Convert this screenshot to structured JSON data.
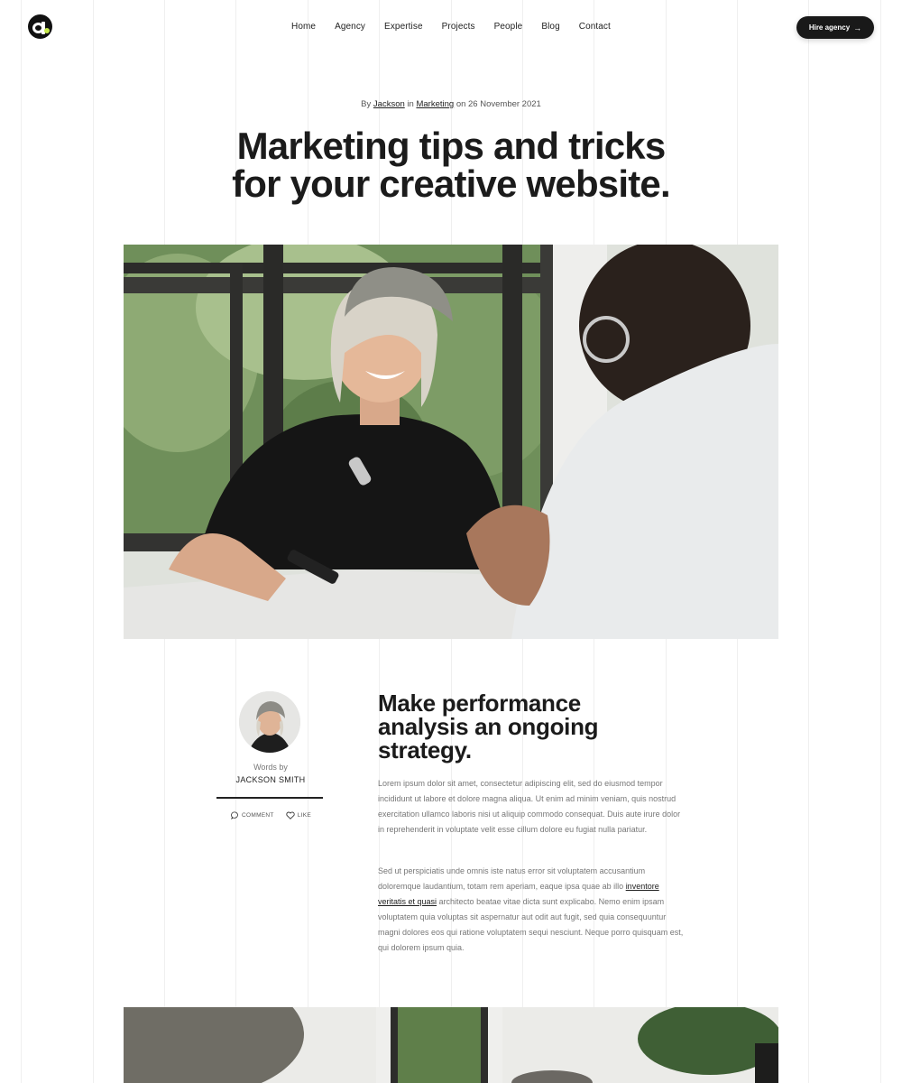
{
  "nav": {
    "items": [
      {
        "label": "Home"
      },
      {
        "label": "Agency"
      },
      {
        "label": "Expertise"
      },
      {
        "label": "Projects"
      },
      {
        "label": "People"
      },
      {
        "label": "Blog"
      },
      {
        "label": "Contact"
      }
    ],
    "cta_label": "Hire agency"
  },
  "post": {
    "meta": {
      "by": "By",
      "author": "Jackson",
      "in": "in",
      "category": "Marketing",
      "on": "on 26 November 2021"
    },
    "title_line1": "Marketing tips and tricks",
    "title_line2": "for your creative website."
  },
  "author": {
    "words_by": "Words by",
    "name": "JACKSON SMITH",
    "comment_label": "COMMENT",
    "like_label": "LIKE"
  },
  "article": {
    "heading": "Make performance analysis an ongoing strategy.",
    "paragraph1": "Lorem ipsum dolor sit amet, consectetur adipiscing elit, sed do eiusmod tempor incididunt ut labore et dolore magna aliqua. Ut enim ad minim veniam, quis nostrud exercitation ullamco laboris nisi ut aliquip commodo consequat. Duis aute irure dolor in reprehenderit in voluptate velit esse cillum dolore eu fugiat nulla pariatur.",
    "paragraph2_before": "Sed ut perspiciatis unde omnis iste natus error sit voluptatem accusantium doloremque laudantium, totam rem aperiam, eaque ipsa quae ab illo",
    "paragraph2_link": "inventore veritatis et quasi",
    "paragraph2_after": "architecto beatae vitae dicta sunt explicabo. Nemo enim ipsam voluptatem quia voluptas sit aspernatur aut odit aut fugit, sed quia consequuntur magni dolores eos qui ratione voluptatem sequi nesciunt. Neque porro quisquam est, qui dolorem ipsum quia."
  },
  "colors": {
    "dark": "#191919",
    "accent_lime": "#c5e84a",
    "text_muted": "#777777",
    "grid_line": "#efefef"
  }
}
